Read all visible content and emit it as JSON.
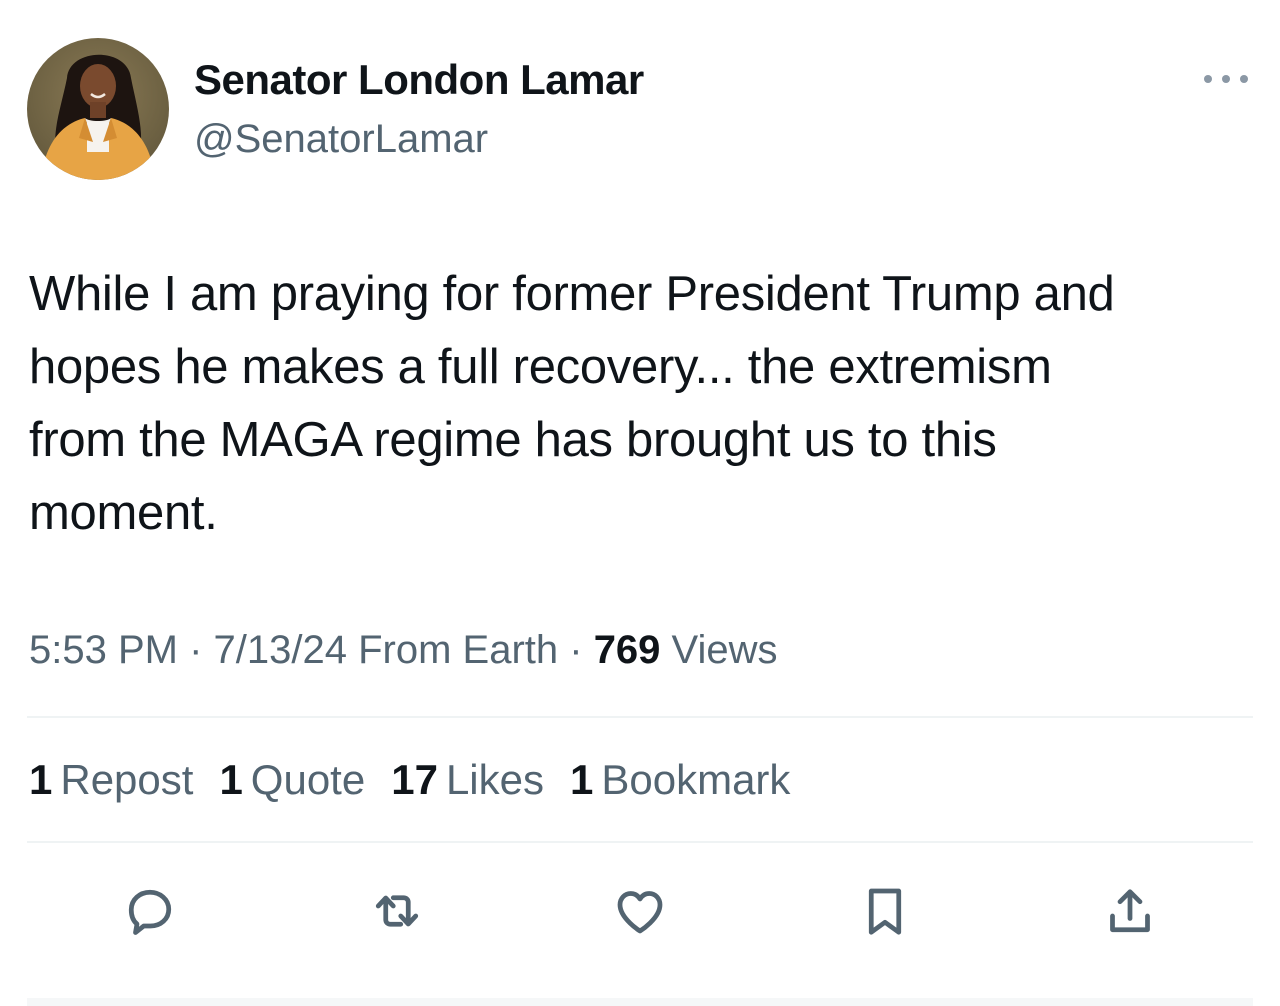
{
  "author": {
    "display_name": "Senator London Lamar",
    "handle": "@SenatorLamar"
  },
  "tweet": {
    "lines": [
      "While I am praying for former President Trump and",
      "hopes he makes a full recovery... the extremism",
      "from the MAGA regime has brought us to this",
      "moment."
    ]
  },
  "meta": {
    "time": "5:53 PM",
    "sep1": " · ",
    "date": "7/13/24",
    "source": " From Earth",
    "sep2": " · ",
    "views_count": "769",
    "views_label": " Views"
  },
  "stats": {
    "reposts_count": "1",
    "reposts_label": "Repost",
    "quotes_count": "1",
    "quotes_label": "Quote",
    "likes_count": "17",
    "likes_label": "Likes",
    "bookmarks_count": "1",
    "bookmarks_label": "Bookmark"
  },
  "actions": {
    "icons": [
      "reply-icon",
      "repost-icon",
      "like-icon",
      "bookmark-icon",
      "share-icon"
    ]
  },
  "colors": {
    "text_primary": "#0f1419",
    "text_secondary": "#536471",
    "divider": "#eff3f4"
  }
}
